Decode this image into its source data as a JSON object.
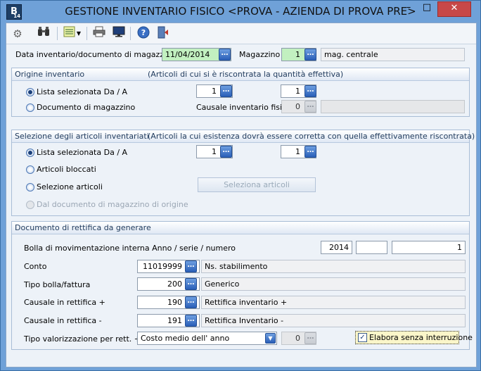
{
  "window": {
    "title": "GESTIONE INVENTARIO FISICO <PROVA - AZIENDA DI PROVA PRE>",
    "app_icon_letter": "B",
    "app_icon_sub": "14"
  },
  "toolbar": {
    "icons": [
      "gear-icon",
      "binoculars-icon",
      "list-settings-icon",
      "printer-icon",
      "monitor-icon",
      "help-icon",
      "exit-door-icon"
    ]
  },
  "header": {
    "date_label": "Data inventario/documento di magazzino",
    "date_value": "11/04/2014",
    "magazzino_label": "Magazzino",
    "magazzino_value": "1",
    "magazzino_desc": "mag. centrale"
  },
  "origine": {
    "title": "Origine inventario",
    "subtitle": "(Articoli di cui si è riscontrata la quantità effettiva)",
    "opt_lista": "Lista selezionata Da / A",
    "opt_documento": "Documento di magazzino",
    "da_value": "1",
    "a_value": "1",
    "causale_label": "Causale inventario fisico",
    "causale_value": "0",
    "causale_desc": ""
  },
  "selezione": {
    "title": "Selezione degli articoli inventariati",
    "subtitle": "(Articoli la cui esistenza dovrà essere corretta con quella effettivamente riscontrata)",
    "opt_lista": "Lista selezionata Da / A",
    "opt_bloccati": "Articoli bloccati",
    "opt_selezione": "Selezione articoli",
    "opt_dal_documento": "Dal documento di magazzino di origine",
    "da_value": "1",
    "a_value": "1",
    "button_label": "Seleziona articoli"
  },
  "documento": {
    "title": "Documento di rettifica da generare",
    "bolla_label": "Bolla di movimentazione interna Anno / serie / numero",
    "anno": "2014",
    "serie": "",
    "numero": "1",
    "conto_label": "Conto",
    "conto_value": "11019999",
    "conto_desc": "Ns. stabilimento",
    "tipo_bolla_label": "Tipo bolla/fattura",
    "tipo_bolla_value": "200",
    "tipo_bolla_desc": "Generico",
    "causale_plus_label": "Causale in rettifica +",
    "causale_plus_value": "190",
    "causale_plus_desc": "Rettifica inventario +",
    "causale_minus_label": "Causale in rettifica -",
    "causale_minus_value": "191",
    "causale_minus_desc": "Rettifica Inventario -",
    "tipo_val_label": "Tipo valorizzazione  per rett. +",
    "tipo_val_value": "Costo medio dell' anno",
    "tipo_val_num": "0",
    "elabora_label": "Elabora senza interruzione"
  }
}
